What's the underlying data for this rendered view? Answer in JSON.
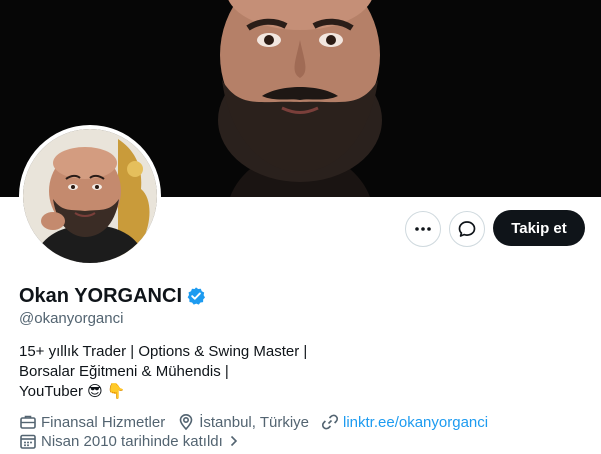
{
  "profile": {
    "name": "Okan YORGANCI",
    "handle": "@okanyorganci",
    "bio_lines": [
      "15+ yıllık Trader | Options & Swing Master |",
      "Borsalar Eğitmeni & Mühendis |",
      "YouTuber 😎 👇"
    ],
    "category": "Finansal Hizmetler",
    "location": "İstanbul, Türkiye",
    "website": "linktr.ee/okanyorganci",
    "joined": "Nisan 2010 tarihinde katıldı"
  },
  "actions": {
    "follow_label": "Takip et"
  },
  "icons": {
    "more": "more-icon",
    "message": "message-icon",
    "verified": "verified-badge-icon",
    "briefcase": "briefcase-icon",
    "location": "location-pin-icon",
    "link": "link-icon",
    "calendar": "calendar-icon",
    "chevron": "chevron-right-icon"
  },
  "colors": {
    "accent": "#1d9bf0",
    "text_primary": "#0f1419",
    "text_secondary": "#536471",
    "button_dark": "#0f1419"
  }
}
